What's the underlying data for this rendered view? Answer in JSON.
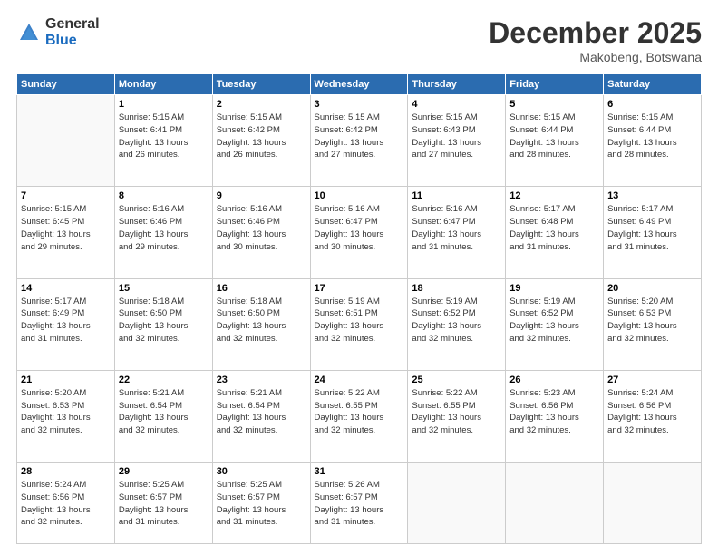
{
  "logo": {
    "general": "General",
    "blue": "Blue"
  },
  "title": "December 2025",
  "location": "Makobeng, Botswana",
  "days_of_week": [
    "Sunday",
    "Monday",
    "Tuesday",
    "Wednesday",
    "Thursday",
    "Friday",
    "Saturday"
  ],
  "weeks": [
    [
      {
        "day": "",
        "info": ""
      },
      {
        "day": "1",
        "info": "Sunrise: 5:15 AM\nSunset: 6:41 PM\nDaylight: 13 hours\nand 26 minutes."
      },
      {
        "day": "2",
        "info": "Sunrise: 5:15 AM\nSunset: 6:42 PM\nDaylight: 13 hours\nand 26 minutes."
      },
      {
        "day": "3",
        "info": "Sunrise: 5:15 AM\nSunset: 6:42 PM\nDaylight: 13 hours\nand 27 minutes."
      },
      {
        "day": "4",
        "info": "Sunrise: 5:15 AM\nSunset: 6:43 PM\nDaylight: 13 hours\nand 27 minutes."
      },
      {
        "day": "5",
        "info": "Sunrise: 5:15 AM\nSunset: 6:44 PM\nDaylight: 13 hours\nand 28 minutes."
      },
      {
        "day": "6",
        "info": "Sunrise: 5:15 AM\nSunset: 6:44 PM\nDaylight: 13 hours\nand 28 minutes."
      }
    ],
    [
      {
        "day": "7",
        "info": "Sunrise: 5:15 AM\nSunset: 6:45 PM\nDaylight: 13 hours\nand 29 minutes."
      },
      {
        "day": "8",
        "info": "Sunrise: 5:16 AM\nSunset: 6:46 PM\nDaylight: 13 hours\nand 29 minutes."
      },
      {
        "day": "9",
        "info": "Sunrise: 5:16 AM\nSunset: 6:46 PM\nDaylight: 13 hours\nand 30 minutes."
      },
      {
        "day": "10",
        "info": "Sunrise: 5:16 AM\nSunset: 6:47 PM\nDaylight: 13 hours\nand 30 minutes."
      },
      {
        "day": "11",
        "info": "Sunrise: 5:16 AM\nSunset: 6:47 PM\nDaylight: 13 hours\nand 31 minutes."
      },
      {
        "day": "12",
        "info": "Sunrise: 5:17 AM\nSunset: 6:48 PM\nDaylight: 13 hours\nand 31 minutes."
      },
      {
        "day": "13",
        "info": "Sunrise: 5:17 AM\nSunset: 6:49 PM\nDaylight: 13 hours\nand 31 minutes."
      }
    ],
    [
      {
        "day": "14",
        "info": "Sunrise: 5:17 AM\nSunset: 6:49 PM\nDaylight: 13 hours\nand 31 minutes."
      },
      {
        "day": "15",
        "info": "Sunrise: 5:18 AM\nSunset: 6:50 PM\nDaylight: 13 hours\nand 32 minutes."
      },
      {
        "day": "16",
        "info": "Sunrise: 5:18 AM\nSunset: 6:50 PM\nDaylight: 13 hours\nand 32 minutes."
      },
      {
        "day": "17",
        "info": "Sunrise: 5:19 AM\nSunset: 6:51 PM\nDaylight: 13 hours\nand 32 minutes."
      },
      {
        "day": "18",
        "info": "Sunrise: 5:19 AM\nSunset: 6:52 PM\nDaylight: 13 hours\nand 32 minutes."
      },
      {
        "day": "19",
        "info": "Sunrise: 5:19 AM\nSunset: 6:52 PM\nDaylight: 13 hours\nand 32 minutes."
      },
      {
        "day": "20",
        "info": "Sunrise: 5:20 AM\nSunset: 6:53 PM\nDaylight: 13 hours\nand 32 minutes."
      }
    ],
    [
      {
        "day": "21",
        "info": "Sunrise: 5:20 AM\nSunset: 6:53 PM\nDaylight: 13 hours\nand 32 minutes."
      },
      {
        "day": "22",
        "info": "Sunrise: 5:21 AM\nSunset: 6:54 PM\nDaylight: 13 hours\nand 32 minutes."
      },
      {
        "day": "23",
        "info": "Sunrise: 5:21 AM\nSunset: 6:54 PM\nDaylight: 13 hours\nand 32 minutes."
      },
      {
        "day": "24",
        "info": "Sunrise: 5:22 AM\nSunset: 6:55 PM\nDaylight: 13 hours\nand 32 minutes."
      },
      {
        "day": "25",
        "info": "Sunrise: 5:22 AM\nSunset: 6:55 PM\nDaylight: 13 hours\nand 32 minutes."
      },
      {
        "day": "26",
        "info": "Sunrise: 5:23 AM\nSunset: 6:56 PM\nDaylight: 13 hours\nand 32 minutes."
      },
      {
        "day": "27",
        "info": "Sunrise: 5:24 AM\nSunset: 6:56 PM\nDaylight: 13 hours\nand 32 minutes."
      }
    ],
    [
      {
        "day": "28",
        "info": "Sunrise: 5:24 AM\nSunset: 6:56 PM\nDaylight: 13 hours\nand 32 minutes."
      },
      {
        "day": "29",
        "info": "Sunrise: 5:25 AM\nSunset: 6:57 PM\nDaylight: 13 hours\nand 31 minutes."
      },
      {
        "day": "30",
        "info": "Sunrise: 5:25 AM\nSunset: 6:57 PM\nDaylight: 13 hours\nand 31 minutes."
      },
      {
        "day": "31",
        "info": "Sunrise: 5:26 AM\nSunset: 6:57 PM\nDaylight: 13 hours\nand 31 minutes."
      },
      {
        "day": "",
        "info": ""
      },
      {
        "day": "",
        "info": ""
      },
      {
        "day": "",
        "info": ""
      }
    ]
  ]
}
